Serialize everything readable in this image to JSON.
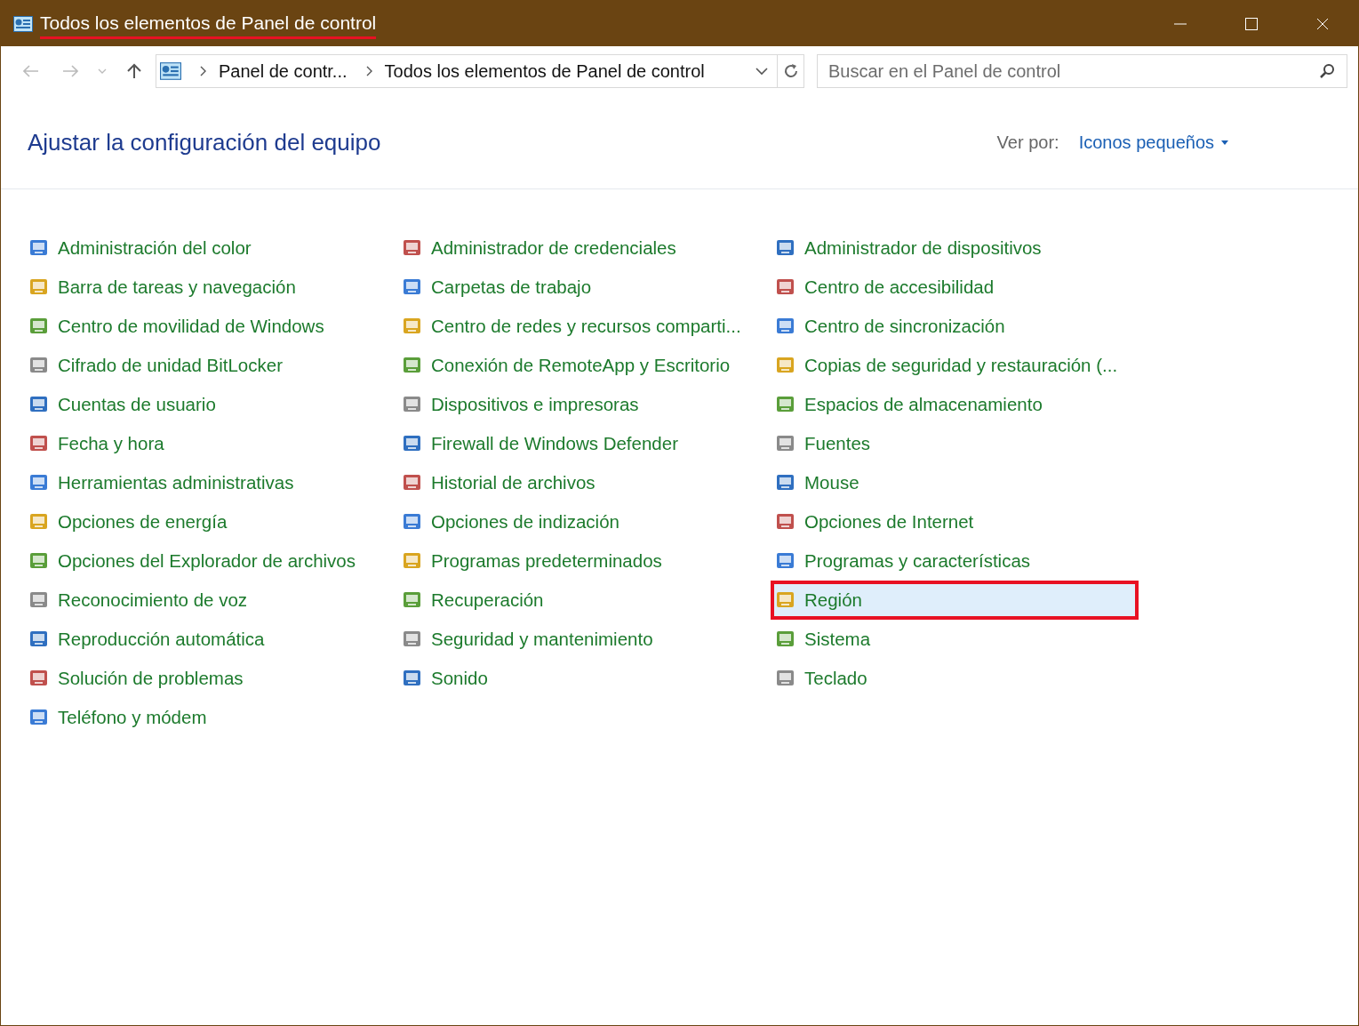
{
  "window": {
    "title": "Todos los elementos de Panel de control",
    "title_underlined": true
  },
  "address_bar": {
    "crumbs": [
      "Panel de contr...",
      "Todos los elementos de Panel de control"
    ]
  },
  "search": {
    "placeholder": "Buscar en el Panel de control"
  },
  "header": {
    "title": "Ajustar la configuración del equipo",
    "view_label": "Ver por:",
    "view_value": "Iconos pequeños"
  },
  "columns": [
    {
      "items": [
        {
          "label": "Administración del color",
          "selected": false
        },
        {
          "label": "Barra de tareas y navegación",
          "selected": false
        },
        {
          "label": "Centro de movilidad de Windows",
          "selected": false
        },
        {
          "label": "Cifrado de unidad BitLocker",
          "selected": false
        },
        {
          "label": "Cuentas de usuario",
          "selected": false
        },
        {
          "label": "Fecha y hora",
          "selected": false
        },
        {
          "label": "Herramientas administrativas",
          "selected": false
        },
        {
          "label": "Opciones de energía",
          "selected": false
        },
        {
          "label": "Opciones del Explorador de archivos",
          "selected": false
        },
        {
          "label": "Reconocimiento de voz",
          "selected": false
        },
        {
          "label": "Reproducción automática",
          "selected": false
        },
        {
          "label": "Solución de problemas",
          "selected": false
        },
        {
          "label": "Teléfono y módem",
          "selected": false
        }
      ]
    },
    {
      "items": [
        {
          "label": "Administrador de credenciales",
          "selected": false
        },
        {
          "label": "Carpetas de trabajo",
          "selected": false
        },
        {
          "label": "Centro de redes y recursos comparti...",
          "selected": false
        },
        {
          "label": "Conexión de RemoteApp y Escritorio",
          "selected": false
        },
        {
          "label": "Dispositivos e impresoras",
          "selected": false
        },
        {
          "label": "Firewall de Windows Defender",
          "selected": false
        },
        {
          "label": "Historial de archivos",
          "selected": false
        },
        {
          "label": "Opciones de indización",
          "selected": false
        },
        {
          "label": "Programas predeterminados",
          "selected": false
        },
        {
          "label": "Recuperación",
          "selected": false
        },
        {
          "label": "Seguridad y mantenimiento",
          "selected": false
        },
        {
          "label": "Sonido",
          "selected": false
        }
      ]
    },
    {
      "items": [
        {
          "label": "Administrador de dispositivos",
          "selected": false
        },
        {
          "label": "Centro de accesibilidad",
          "selected": false
        },
        {
          "label": "Centro de sincronización",
          "selected": false
        },
        {
          "label": "Copias de seguridad y restauración (...",
          "selected": false
        },
        {
          "label": "Espacios de almacenamiento",
          "selected": false
        },
        {
          "label": "Fuentes",
          "selected": false
        },
        {
          "label": "Mouse",
          "selected": false
        },
        {
          "label": "Opciones de Internet",
          "selected": false
        },
        {
          "label": "Programas y características",
          "selected": false
        },
        {
          "label": "Región",
          "selected": true
        },
        {
          "label": "Sistema",
          "selected": false
        },
        {
          "label": "Teclado",
          "selected": false
        }
      ]
    }
  ]
}
